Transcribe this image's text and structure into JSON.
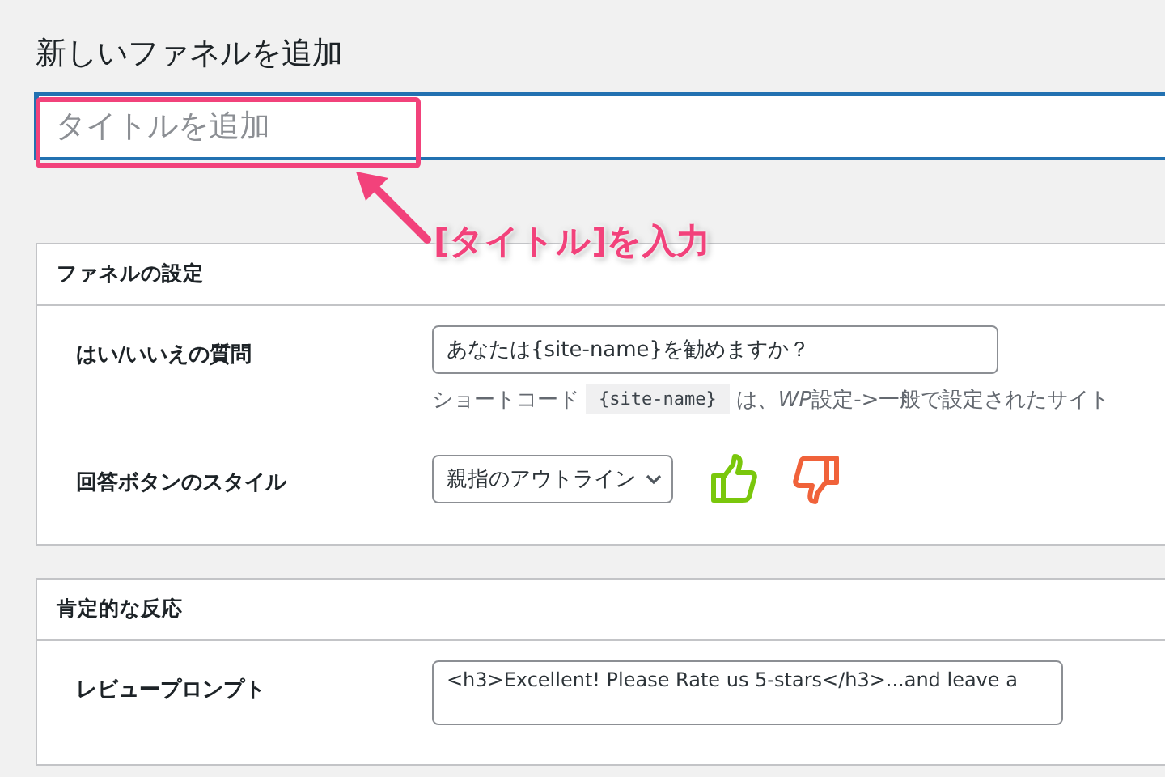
{
  "page_title": "新しいファネルを追加",
  "title_field": {
    "placeholder": "タイトルを追加"
  },
  "annotation": {
    "label": "[タイトル]を入力"
  },
  "sections": [
    {
      "heading": "ファネルの設定",
      "rows": [
        {
          "kind": "text",
          "label": "はい/いいえの質問",
          "value": "あなたは{site-name}を勧めますか？",
          "help_before": "ショートコード",
          "help_code": "{site-name}",
          "help_mid": "は、",
          "help_italic": "WP",
          "help_after": "設定->一般で設定されたサイト"
        },
        {
          "kind": "select",
          "label": "回答ボタンのスタイル",
          "value": "親指のアウトライン"
        }
      ]
    },
    {
      "heading": "肯定的な反応",
      "rows": [
        {
          "kind": "textarea",
          "label": "レビュープロンプト",
          "value": "<h3>Excellent! Please Rate us 5-stars</h3>...and leave a"
        }
      ]
    }
  ]
}
